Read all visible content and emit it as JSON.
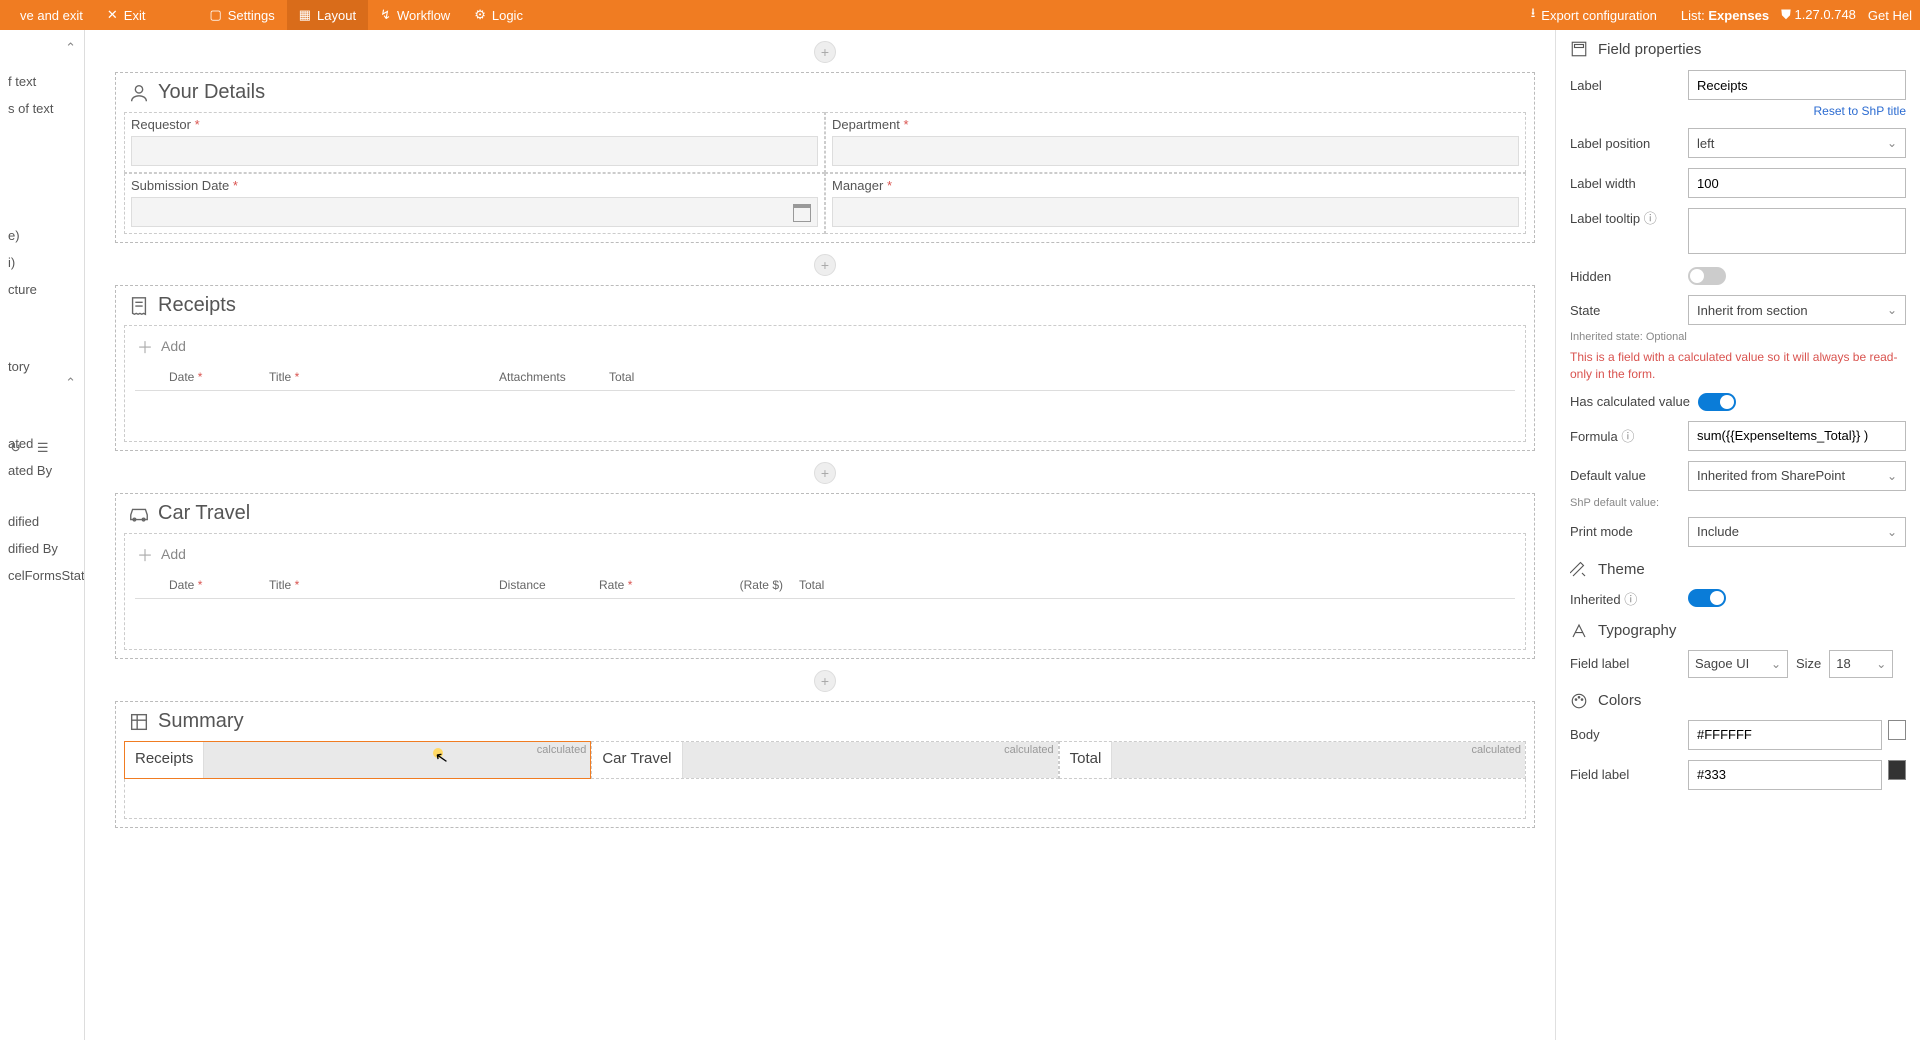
{
  "topbar": {
    "save_exit": "ve and exit",
    "exit": "Exit",
    "settings": "Settings",
    "layout": "Layout",
    "workflow": "Workflow",
    "logic": "Logic",
    "export": "Export configuration",
    "list_label": "List:",
    "list_value": "Expenses",
    "version": "1.27.0.748",
    "help": "Get Hel"
  },
  "left": {
    "items_top": [
      "f text",
      "s of text"
    ],
    "items_mid": [
      "e)",
      "i)",
      "cture"
    ],
    "items_bot": [
      "tory"
    ],
    "items_foot": [
      "ated",
      "ated By",
      "dified",
      "dified By",
      "celFormsStatus"
    ]
  },
  "sections": {
    "your_details": {
      "title": "Your Details",
      "fields": {
        "requestor": "Requestor",
        "department": "Department",
        "submission_date": "Submission Date",
        "manager": "Manager"
      }
    },
    "receipts": {
      "title": "Receipts",
      "add": "Add",
      "headers": [
        "Date",
        "Title",
        "Attachments",
        "Total"
      ]
    },
    "car_travel": {
      "title": "Car Travel",
      "add": "Add",
      "headers": [
        "Date",
        "Title",
        "Distance",
        "Rate",
        "(Rate $)",
        "Total"
      ]
    },
    "summary": {
      "title": "Summary",
      "cells": [
        "Receipts",
        "Car Travel",
        "Total"
      ],
      "calc": "calculated"
    }
  },
  "props": {
    "header": "Field properties",
    "label": "Label",
    "label_value": "Receipts",
    "reset": "Reset to ShP title",
    "label_position": "Label position",
    "label_position_value": "left",
    "label_width": "Label width",
    "label_width_value": "100",
    "label_tooltip": "Label tooltip",
    "hidden": "Hidden",
    "state": "State",
    "state_value": "Inherit from section",
    "inherited_state": "Inherited state: Optional",
    "calc_warn": "This is a field with a calculated value so it will always be read-only in the form.",
    "has_calc": "Has calculated value",
    "formula": "Formula",
    "formula_value": "sum({{ExpenseItems_Total}} )",
    "default_value": "Default value",
    "default_value_value": "Inherited from SharePoint",
    "shp_default": "ShP default value:",
    "print_mode": "Print mode",
    "print_mode_value": "Include",
    "theme": "Theme",
    "inherited": "Inherited",
    "typography": "Typography",
    "field_label": "Field label",
    "font": "Sagoe UI",
    "size_label": "Size",
    "size_value": "18",
    "colors": "Colors",
    "body": "Body",
    "body_value": "#FFFFFF",
    "field_label_color": "Field label",
    "field_label_color_value": "#333"
  }
}
